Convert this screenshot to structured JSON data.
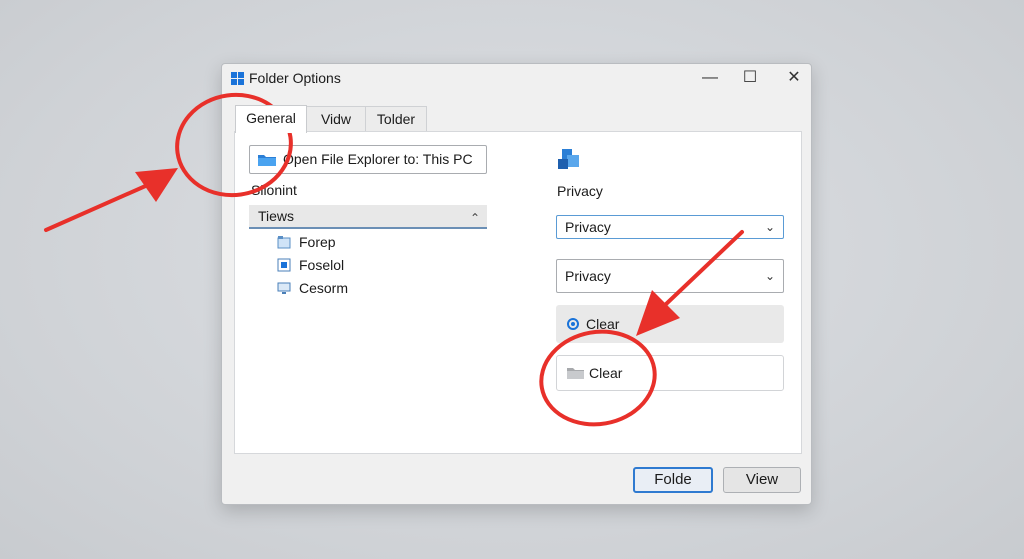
{
  "window": {
    "title": "Folder Options",
    "controls": {
      "minimize": "—",
      "maximize": "☐",
      "close": "✕"
    }
  },
  "tabs": [
    {
      "label": "General",
      "active": true
    },
    {
      "label": "Vidw",
      "active": false
    },
    {
      "label": "Tolder",
      "active": false
    }
  ],
  "general": {
    "open_file_explorer_to": "Open File Explorer to: This PC",
    "section_label": "Silonint",
    "tree": {
      "header": "Tiews",
      "items": [
        {
          "label": "Forep",
          "icon": "folder-icon"
        },
        {
          "label": "Foselol",
          "icon": "square-icon"
        },
        {
          "label": "Cesorm",
          "icon": "monitor-icon"
        }
      ]
    }
  },
  "privacy": {
    "heading": "Privacy",
    "select_1": "Privacy",
    "select_2": "Privacy",
    "radio_label": "Clear",
    "clear_button": "Clear"
  },
  "footer": {
    "primary_button": "Folde",
    "secondary_button": "View"
  },
  "annotations": {
    "color": "#e8302a",
    "marks": [
      "circle",
      "arrow",
      "circle",
      "arrow"
    ]
  }
}
